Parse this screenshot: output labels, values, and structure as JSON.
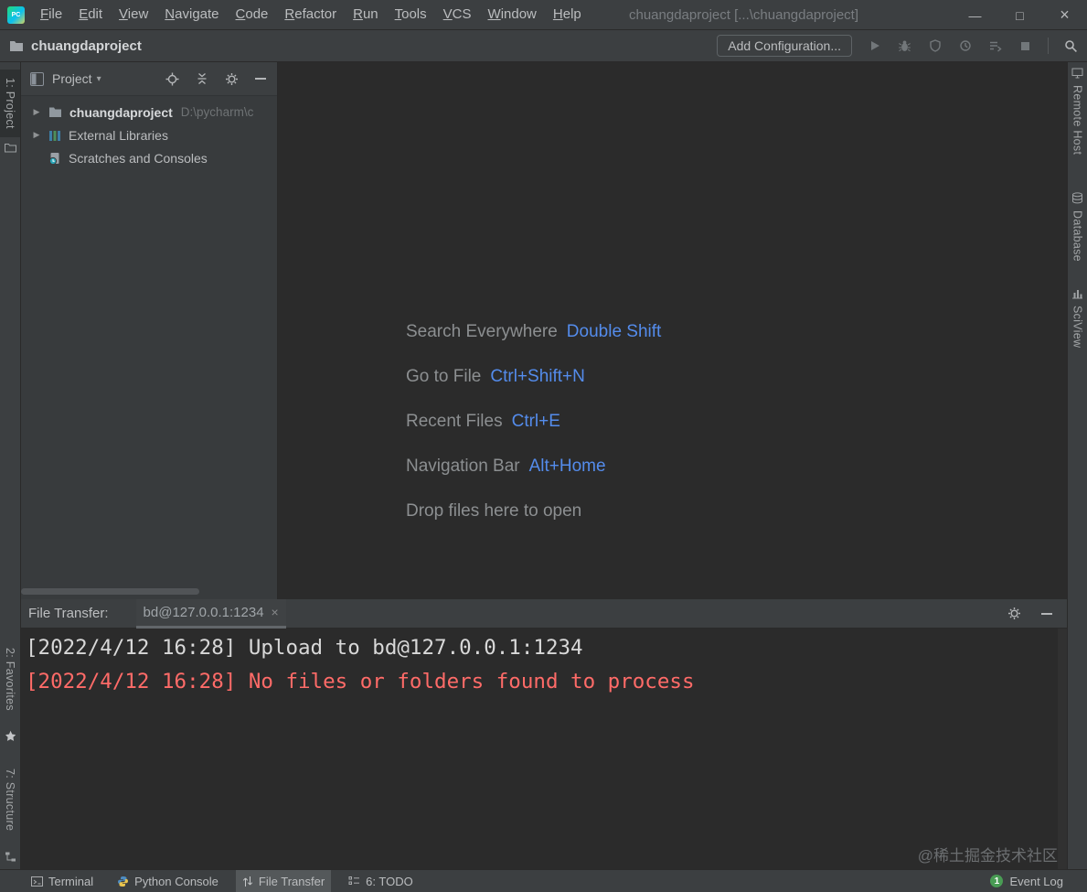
{
  "titlebar": {
    "menu": [
      "File",
      "Edit",
      "View",
      "Navigate",
      "Code",
      "Refactor",
      "Run",
      "Tools",
      "VCS",
      "Window",
      "Help"
    ],
    "title": "chuangdaproject [...\\chuangdaproject]",
    "logo_text": "PC",
    "controls": {
      "minimize": "—",
      "maximize": "□",
      "close": "×"
    }
  },
  "toolbar": {
    "breadcrumb": "chuangdaproject",
    "add_configuration": "Add Configuration..."
  },
  "left_stripe": {
    "project": "1: Project",
    "favorites": "2: Favorites",
    "structure": "7: Structure"
  },
  "right_stripe": {
    "remote_host": "Remote Host",
    "database": "Database",
    "sciview": "SciView"
  },
  "project_panel": {
    "title": "Project",
    "tree": [
      {
        "name": "chuangdaproject",
        "path": "D:\\pycharm\\c"
      },
      {
        "name": "External Libraries",
        "path": ""
      },
      {
        "name": "Scratches and Consoles",
        "path": ""
      }
    ]
  },
  "editor_overlay": {
    "shortcuts": [
      {
        "label": "Search Everywhere",
        "keys": "Double Shift"
      },
      {
        "label": "Go to File",
        "keys": "Ctrl+Shift+N"
      },
      {
        "label": "Recent Files",
        "keys": "Ctrl+E"
      },
      {
        "label": "Navigation Bar",
        "keys": "Alt+Home"
      },
      {
        "label": "Drop files here to open",
        "keys": ""
      }
    ]
  },
  "bottom_panel": {
    "label": "File Transfer:",
    "tab": "bd@127.0.0.1:1234",
    "tab_close": "×",
    "lines": [
      {
        "text": "[2022/4/12 16:28] Upload to bd@127.0.0.1:1234",
        "level": "info"
      },
      {
        "text": "[2022/4/12 16:28] No files or folders found to process",
        "level": "error"
      }
    ]
  },
  "statusbar": {
    "terminal": "Terminal",
    "python_console": "Python Console",
    "file_transfer": "File Transfer",
    "todo": "6: TODO",
    "event_log": "Event Log",
    "event_count": "1"
  },
  "watermark": "@稀土掘金技术社区",
  "colors": {
    "shortcut_key_blue": "#548cec",
    "console_error_red": "#ff6b68",
    "event_badge_green": "#499c54"
  }
}
